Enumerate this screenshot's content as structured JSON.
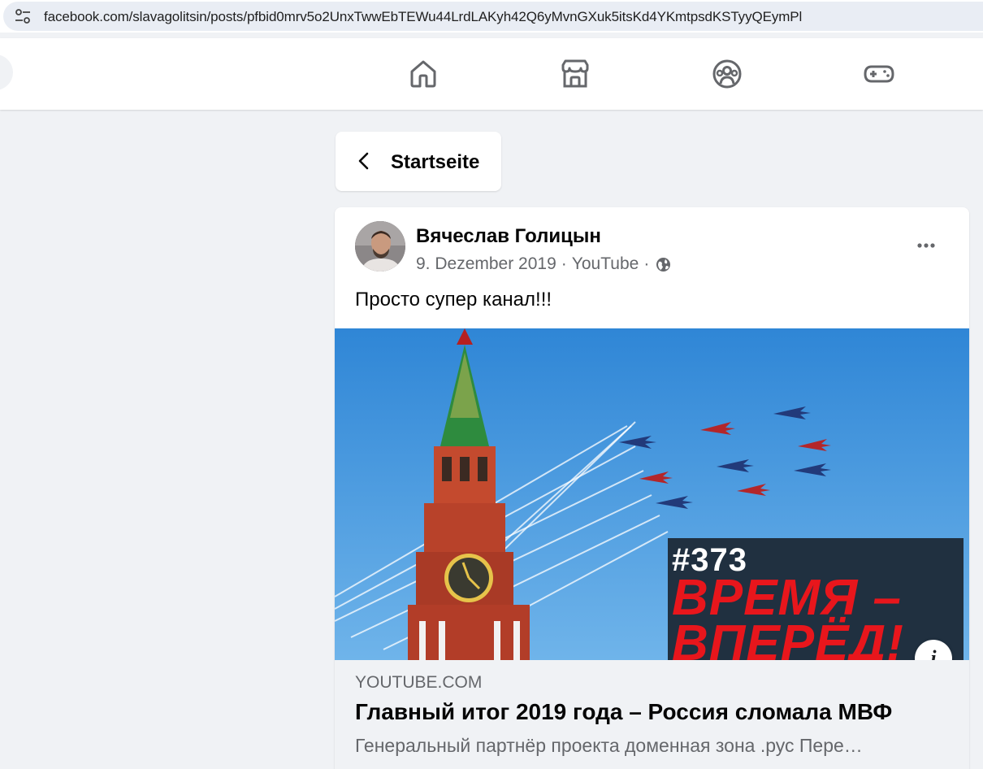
{
  "browser": {
    "url": "facebook.com/slavagolitsin/posts/pfbid0mrv5o2UnxTwwEbTEWu44LrdLAKyh42Q6yMvnGXuk5itsKd4YKmtpsdKSTyyQEymPl",
    "site_icon": "site-settings-icon"
  },
  "nav": {
    "icons": [
      "home-icon",
      "marketplace-icon",
      "groups-icon",
      "gaming-icon"
    ]
  },
  "back": {
    "label": "Startseite"
  },
  "post": {
    "author": "Вячеслав Голицын",
    "date": "9. Dezember 2019",
    "source": "YouTube",
    "separator": "·",
    "privacy_icon": "globe-icon",
    "text": "Просто супер канал!!!",
    "media": {
      "episode": "#373",
      "title_line1": "ВРЕМЯ –",
      "title_line2": "ВПЕРЁД!"
    },
    "info_label": "i",
    "link": {
      "domain": "YOUTUBE.COM",
      "title": "Главный итог 2019 года – Россия сломала МВФ",
      "description": "Генеральный партнёр проекта доменная зона .рус Пере…"
    }
  },
  "colors": {
    "page_bg": "#f0f2f5",
    "text_primary": "#050505",
    "text_secondary": "#65676b",
    "headline_red": "#e8161c",
    "sky_blue": "#4d9ce0"
  }
}
